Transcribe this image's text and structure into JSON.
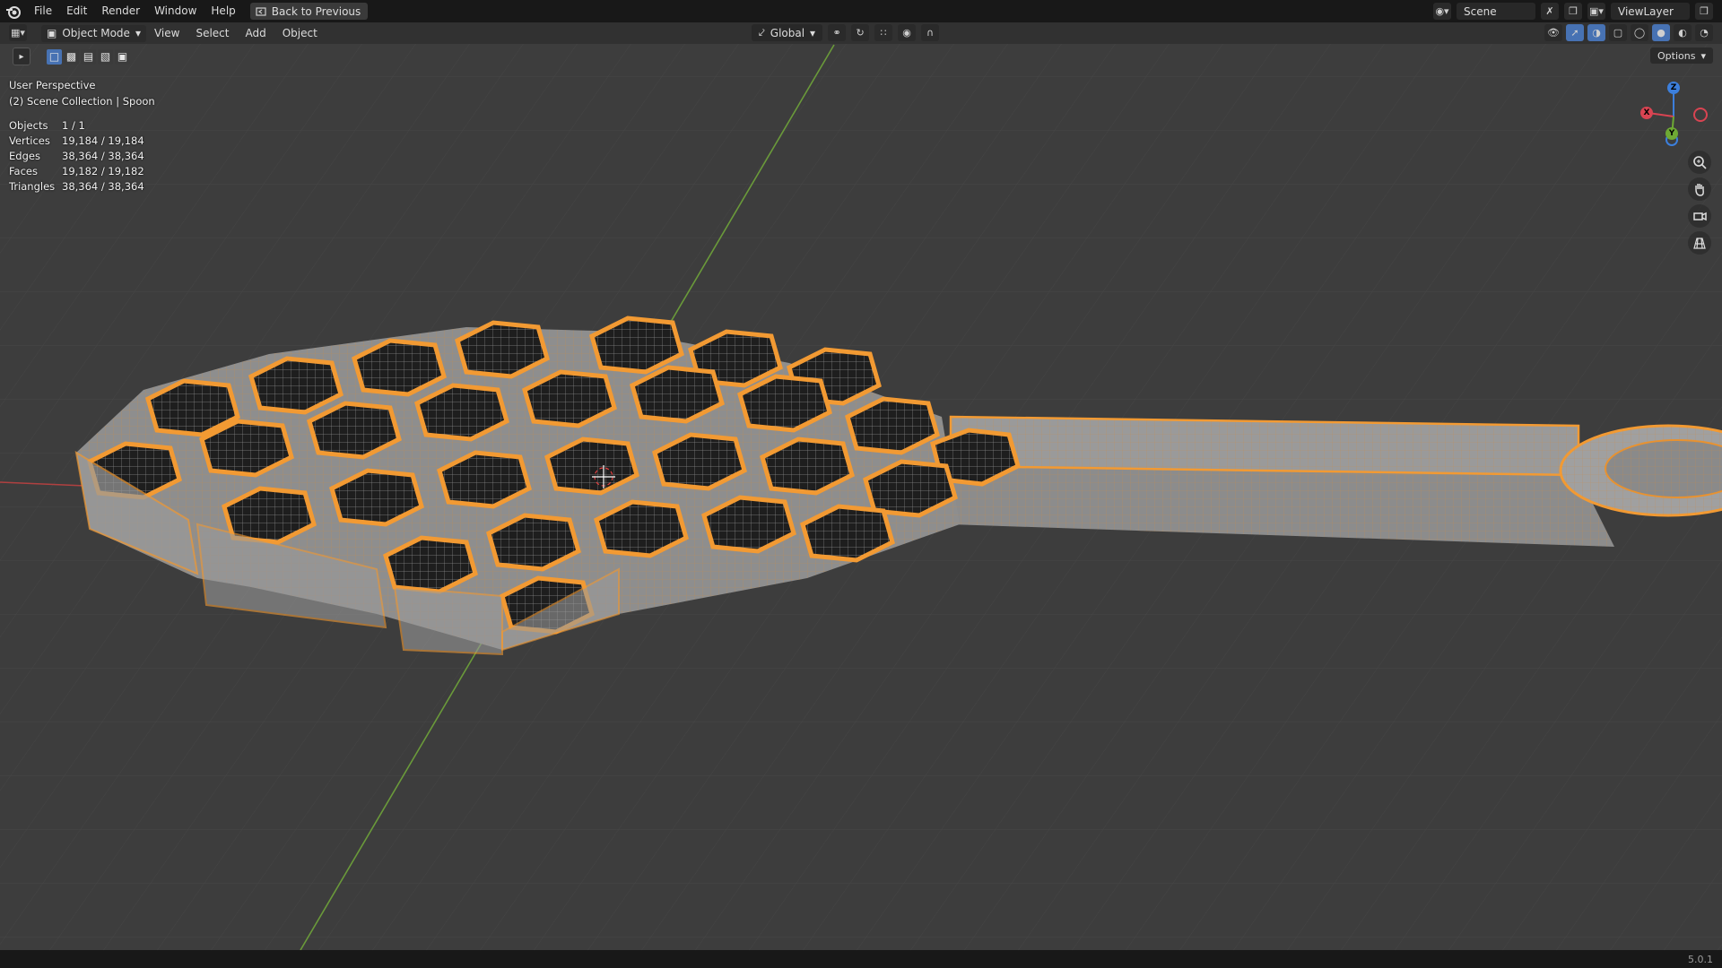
{
  "menubar": {
    "items": [
      "File",
      "Edit",
      "Render",
      "Window",
      "Help"
    ],
    "back_button": "Back to Previous",
    "scene_name": "Scene",
    "view_layer": "ViewLayer"
  },
  "header": {
    "mode": "Object Mode",
    "menus": [
      "View",
      "Select",
      "Add",
      "Object"
    ],
    "transform_orientation": "Global",
    "options_label": "Options"
  },
  "viewport": {
    "perspective": "User Perspective",
    "collection": "(2) Scene Collection | Spoon",
    "stats": [
      {
        "label": "Objects",
        "value": "1 / 1"
      },
      {
        "label": "Vertices",
        "value": "19,184 / 19,184"
      },
      {
        "label": "Edges",
        "value": "38,364 / 38,364"
      },
      {
        "label": "Faces",
        "value": "19,182 / 19,182"
      },
      {
        "label": "Triangles",
        "value": "38,364 / 38,364"
      }
    ],
    "gizmo_axes": {
      "x": "X",
      "y": "Y",
      "z": "Z"
    },
    "colors": {
      "selection": "#f29a33",
      "x_axis": "#d94452",
      "y_axis": "#6ea934",
      "z_axis": "#3c7fdc",
      "background": "#3d3d3d"
    }
  },
  "statusbar": {
    "version": "5.0.1"
  }
}
